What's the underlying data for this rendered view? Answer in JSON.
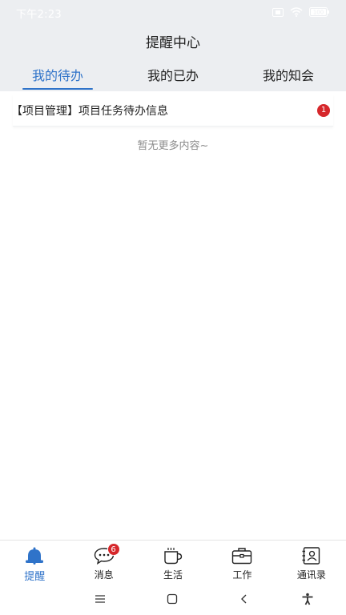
{
  "status_bar": {
    "time": "下午2:23",
    "battery": "100"
  },
  "header": {
    "title": "提醒中心"
  },
  "tabs": [
    {
      "label": "我的待办",
      "active": true
    },
    {
      "label": "我的已办",
      "active": false
    },
    {
      "label": "我的知会",
      "active": false
    }
  ],
  "todo_list": [
    {
      "title": "【项目管理】项目任务待办信息",
      "badge": "1"
    }
  ],
  "empty_tip": "暂无更多内容~",
  "bottom_nav": {
    "items": [
      {
        "label": "提醒",
        "icon": "bell-icon",
        "active": true
      },
      {
        "label": "消息",
        "icon": "chat-icon",
        "badge": "6"
      },
      {
        "label": "生活",
        "icon": "cup-icon"
      },
      {
        "label": "工作",
        "icon": "briefcase-icon"
      },
      {
        "label": "通讯录",
        "icon": "contacts-icon"
      }
    ]
  },
  "colors": {
    "accent": "#2f73c9",
    "badge": "#d6272b",
    "header_bg": "#eceef1"
  }
}
